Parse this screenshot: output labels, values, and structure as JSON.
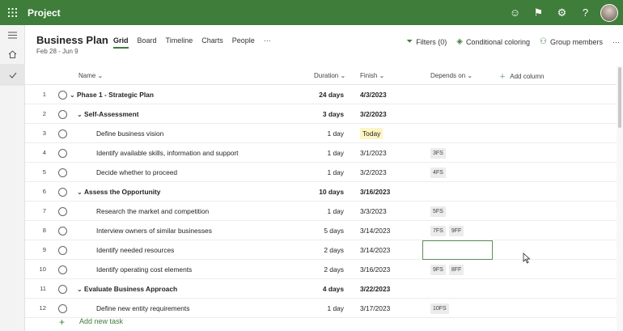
{
  "app": {
    "title": "Project"
  },
  "plan": {
    "title": "Business Plan",
    "dates": "Feb 28 - Jun 9"
  },
  "tabs": [
    "Grid",
    "Board",
    "Timeline",
    "Charts",
    "People"
  ],
  "more_glyph": "···",
  "toolbar": {
    "filters": "Filters (0)",
    "conditional": "Conditional coloring",
    "group": "Group members"
  },
  "columns": {
    "name": "Name",
    "duration": "Duration",
    "finish": "Finish",
    "depends": "Depends on",
    "add": "Add column"
  },
  "rows": [
    {
      "num": "1",
      "name": "Phase 1 - Strategic Plan",
      "duration": "24 days",
      "finish": "4/3/2023",
      "deps": [],
      "level": 0,
      "bold": true
    },
    {
      "num": "2",
      "name": "Self-Assessment",
      "duration": "3 days",
      "finish": "3/2/2023",
      "deps": [],
      "level": 1,
      "bold": true
    },
    {
      "num": "3",
      "name": "Define business vision",
      "duration": "1 day",
      "finish": "Today",
      "deps": [],
      "level": 2,
      "bold": false,
      "today": true
    },
    {
      "num": "4",
      "name": "Identify available skills, information and support",
      "duration": "1 day",
      "finish": "3/1/2023",
      "deps": [
        "3FS"
      ],
      "level": 2,
      "bold": false
    },
    {
      "num": "5",
      "name": "Decide whether to proceed",
      "duration": "1 day",
      "finish": "3/2/2023",
      "deps": [
        "4FS"
      ],
      "level": 2,
      "bold": false
    },
    {
      "num": "6",
      "name": "Assess the Opportunity",
      "duration": "10 days",
      "finish": "3/16/2023",
      "deps": [],
      "level": 1,
      "bold": true
    },
    {
      "num": "7",
      "name": "Research the market and competition",
      "duration": "1 day",
      "finish": "3/3/2023",
      "deps": [
        "5FS"
      ],
      "level": 2,
      "bold": false
    },
    {
      "num": "8",
      "name": "Interview owners of similar businesses",
      "duration": "5 days",
      "finish": "3/14/2023",
      "deps": [
        "7FS",
        "9FF"
      ],
      "level": 2,
      "bold": false
    },
    {
      "num": "9",
      "name": "Identify needed resources",
      "duration": "2 days",
      "finish": "3/14/2023",
      "deps": [],
      "level": 2,
      "bold": false,
      "selected": true
    },
    {
      "num": "10",
      "name": "Identify operating cost elements",
      "duration": "2 days",
      "finish": "3/16/2023",
      "deps": [
        "9FS",
        "8FF"
      ],
      "level": 2,
      "bold": false
    },
    {
      "num": "11",
      "name": "Evaluate Business Approach",
      "duration": "4 days",
      "finish": "3/22/2023",
      "deps": [],
      "level": 1,
      "bold": true
    },
    {
      "num": "12",
      "name": "Define new entity requirements",
      "duration": "1 day",
      "finish": "3/17/2023",
      "deps": [
        "10FS"
      ],
      "level": 2,
      "bold": false
    }
  ],
  "add_task": "Add new task",
  "colors": {
    "brand": "#3f7d3a",
    "today_highlight": "#fdf6c3"
  }
}
